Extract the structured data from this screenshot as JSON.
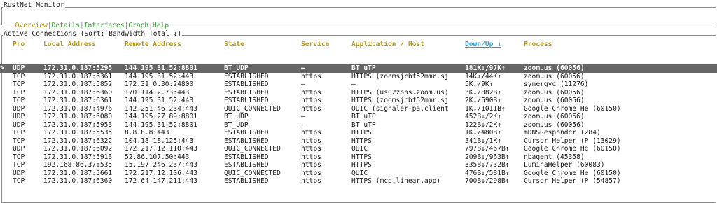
{
  "app": {
    "title": "RustNet Monitor",
    "tabs": [
      {
        "label": "Overview",
        "active": true
      },
      {
        "label": "Details",
        "active": false
      },
      {
        "label": "Interfaces",
        "active": false
      },
      {
        "label": "Graph",
        "active": false
      },
      {
        "label": "Help",
        "active": false
      }
    ],
    "separator": "|"
  },
  "connections": {
    "title": "Active Connections (Sort: Bandwidth Total ↓)",
    "selection_marker": ">",
    "columns": [
      "Pro",
      "Local Address",
      "Remote Address",
      "State",
      "Service",
      "Application / Host",
      "Down/Up ↓",
      "Process"
    ],
    "sorted_column": "Down/Up ↓",
    "rows": [
      {
        "pro": "UDP",
        "local": "172.31.0.187:5295",
        "remote": "144.195.31.52:8801",
        "state": "BT_UDP",
        "service": "—",
        "app": "BT uTP",
        "downup": "181K↓/97K↑",
        "process": "zoom.us (60056)",
        "selected": true
      },
      {
        "pro": "TCP",
        "local": "172.31.0.187:6361",
        "remote": "144.195.31.52:443",
        "state": "ESTABLISHED",
        "service": "https",
        "app": "HTTPS (zoomsjcbf52mmr.sj",
        "downup": "14K↓/44K↑",
        "process": "zoom.us (60056)"
      },
      {
        "pro": "TCP",
        "local": "172.31.0.187:5852",
        "remote": "172.31.0.30:24800",
        "state": "ESTABLISHED",
        "service": "—",
        "app": "—",
        "downup": "5K↓/9K↑",
        "process": "synergyc (11276)"
      },
      {
        "pro": "TCP",
        "local": "172.31.0.187:6360",
        "remote": "170.114.2.73:443",
        "state": "ESTABLISHED",
        "service": "https",
        "app": "HTTPS (us02zpns.zoom.us)",
        "downup": "3K↓/882B↑",
        "process": "zoom.us (60056)"
      },
      {
        "pro": "TCP",
        "local": "172.31.0.187:6361",
        "remote": "144.195.31.52:443",
        "state": "ESTABLISHED",
        "service": "https",
        "app": "HTTPS (zoomsjcbf52mmr.sj",
        "downup": "2K↓/590B↑",
        "process": "zoom.us (60056)"
      },
      {
        "pro": "UDP",
        "local": "172.31.0.187:4976",
        "remote": "142.251.46.234:443",
        "state": "QUIC_CONNECTED",
        "service": "https",
        "app": "QUIC (signaler-pa.client",
        "downup": "1K↓/1011B↑",
        "process": "Google Chrome He (60150)"
      },
      {
        "pro": "UDP",
        "local": "172.31.0.187:6080",
        "remote": "144.195.27.89:8801",
        "state": "BT_UDP",
        "service": "—",
        "app": "BT uTP",
        "downup": "452B↓/2K↑",
        "process": "zoom.us (60056)"
      },
      {
        "pro": "UDP",
        "local": "172.31.0.187:5953",
        "remote": "144.195.31.52:8801",
        "state": "BT_UDP",
        "service": "—",
        "app": "BT uTP",
        "downup": "122B↓/2K↑",
        "process": "zoom.us (60056)"
      },
      {
        "pro": "TCP",
        "local": "172.31.0.187:5535",
        "remote": "8.8.8.8:443",
        "state": "ESTABLISHED",
        "service": "https",
        "app": "HTTPS",
        "downup": "1K↓/480B↑",
        "process": "mDNSResponder (284)"
      },
      {
        "pro": "TCP",
        "local": "172.31.0.187:6322",
        "remote": "104.18.18.125:443",
        "state": "ESTABLISHED",
        "service": "https",
        "app": "HTTPS",
        "downup": "341B↓/1K↑",
        "process": "Cursor Helper (P (13029)"
      },
      {
        "pro": "UDP",
        "local": "172.31.0.187:6092",
        "remote": "172.217.12.110:443",
        "state": "QUIC_CONNECTED",
        "service": "https",
        "app": "QUIC",
        "downup": "797B↓/467B↑",
        "process": "Google Chrome He (60150)"
      },
      {
        "pro": "TCP",
        "local": "172.31.0.187:5913",
        "remote": "52.86.107.50:443",
        "state": "ESTABLISHED",
        "service": "https",
        "app": "HTTPS",
        "downup": "209B↓/963B↑",
        "process": "nbagent (45358)"
      },
      {
        "pro": "TCP",
        "local": "192.168.86.37:535",
        "remote": "15.197.246.237:443",
        "state": "ESTABLISHED",
        "service": "https",
        "app": "HTTPS",
        "downup": "335B↓/732B↑",
        "process": "LuminaHelper (60083)"
      },
      {
        "pro": "UDP",
        "local": "172.31.0.187:5661",
        "remote": "172.217.12.106:443",
        "state": "QUIC_CONNECTED",
        "service": "https",
        "app": "QUIC",
        "downup": "476B↓/581B↑",
        "process": "Google Chrome He (60150)"
      },
      {
        "pro": "TCP",
        "local": "172.31.0.187:6360",
        "remote": "172.64.147.211:443",
        "state": "ESTABLISHED",
        "service": "https",
        "app": "HTTPS (mcp.linear.app)",
        "downup": "700B↓/298B↑",
        "process": "Cursor Helper (P (54857)"
      }
    ]
  }
}
